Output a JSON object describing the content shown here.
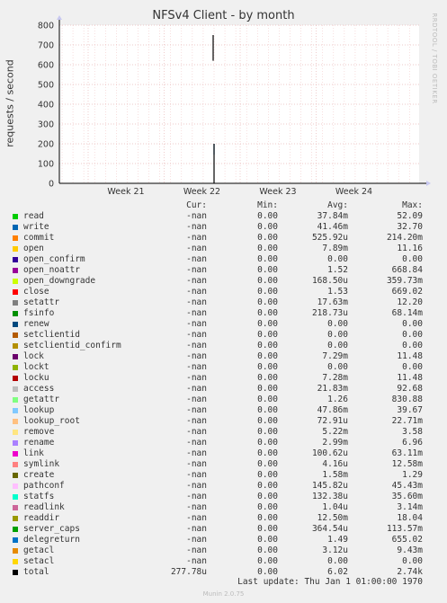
{
  "chart_data": {
    "type": "line",
    "title": "NFSv4 Client - by month",
    "ylabel": "requests / second",
    "ylim": [
      0,
      800
    ],
    "yticks": [
      0,
      100,
      200,
      300,
      400,
      500,
      600,
      700,
      800
    ],
    "xticks": [
      "Week 21",
      "Week 22",
      "Week 23",
      "Week 24"
    ],
    "watermark": "RRDTOOL / TOBI OETIKER",
    "grid": true,
    "spike": {
      "at_week": 22,
      "segments": [
        {
          "series": "total",
          "y0": 620,
          "y1": 750
        },
        {
          "series": "write",
          "y0": 145,
          "y1": 200
        },
        {
          "series": "total",
          "y0": 0,
          "y1": 200
        }
      ]
    },
    "columns": {
      "cur": "Cur:",
      "min": "Min:",
      "avg": "Avg:",
      "max": "Max:"
    },
    "series": [
      {
        "name": "read",
        "color": "#00cc00",
        "cur": "-nan",
        "min": "0.00",
        "avg": "37.84m",
        "max": "52.09"
      },
      {
        "name": "write",
        "color": "#0066b3",
        "cur": "-nan",
        "min": "0.00",
        "avg": "41.46m",
        "max": "32.70"
      },
      {
        "name": "commit",
        "color": "#ff8000",
        "cur": "-nan",
        "min": "0.00",
        "avg": "525.92u",
        "max": "214.20m"
      },
      {
        "name": "open",
        "color": "#ffcc00",
        "cur": "-nan",
        "min": "0.00",
        "avg": "7.89m",
        "max": "11.16"
      },
      {
        "name": "open_confirm",
        "color": "#330099",
        "cur": "-nan",
        "min": "0.00",
        "avg": "0.00",
        "max": "0.00"
      },
      {
        "name": "open_noattr",
        "color": "#990099",
        "cur": "-nan",
        "min": "0.00",
        "avg": "1.52",
        "max": "668.84"
      },
      {
        "name": "open_downgrade",
        "color": "#ccff00",
        "cur": "-nan",
        "min": "0.00",
        "avg": "168.50u",
        "max": "359.73m"
      },
      {
        "name": "close",
        "color": "#ff0000",
        "cur": "-nan",
        "min": "0.00",
        "avg": "1.53",
        "max": "669.02"
      },
      {
        "name": "setattr",
        "color": "#808080",
        "cur": "-nan",
        "min": "0.00",
        "avg": "17.63m",
        "max": "12.20"
      },
      {
        "name": "fsinfo",
        "color": "#008f00",
        "cur": "-nan",
        "min": "0.00",
        "avg": "218.73u",
        "max": "68.14m"
      },
      {
        "name": "renew",
        "color": "#00487d",
        "cur": "-nan",
        "min": "0.00",
        "avg": "0.00",
        "max": "0.00"
      },
      {
        "name": "setclientid",
        "color": "#b35a00",
        "cur": "-nan",
        "min": "0.00",
        "avg": "0.00",
        "max": "0.00"
      },
      {
        "name": "setclientid_confirm",
        "color": "#b38f00",
        "cur": "-nan",
        "min": "0.00",
        "avg": "0.00",
        "max": "0.00"
      },
      {
        "name": "lock",
        "color": "#6b006b",
        "cur": "-nan",
        "min": "0.00",
        "avg": "7.29m",
        "max": "11.48"
      },
      {
        "name": "lockt",
        "color": "#8fb300",
        "cur": "-nan",
        "min": "0.00",
        "avg": "0.00",
        "max": "0.00"
      },
      {
        "name": "locku",
        "color": "#b30000",
        "cur": "-nan",
        "min": "0.00",
        "avg": "7.28m",
        "max": "11.48"
      },
      {
        "name": "access",
        "color": "#bebebe",
        "cur": "-nan",
        "min": "0.00",
        "avg": "21.83m",
        "max": "92.68"
      },
      {
        "name": "getattr",
        "color": "#80ff80",
        "cur": "-nan",
        "min": "0.00",
        "avg": "1.26",
        "max": "830.88"
      },
      {
        "name": "lookup",
        "color": "#80c9ff",
        "cur": "-nan",
        "min": "0.00",
        "avg": "47.86m",
        "max": "39.67"
      },
      {
        "name": "lookup_root",
        "color": "#ffc080",
        "cur": "-nan",
        "min": "0.00",
        "avg": "72.91u",
        "max": "22.71m"
      },
      {
        "name": "remove",
        "color": "#ffe680",
        "cur": "-nan",
        "min": "0.00",
        "avg": "5.22m",
        "max": "3.58"
      },
      {
        "name": "rename",
        "color": "#aa80ff",
        "cur": "-nan",
        "min": "0.00",
        "avg": "2.99m",
        "max": "6.96"
      },
      {
        "name": "link",
        "color": "#ee00cc",
        "cur": "-nan",
        "min": "0.00",
        "avg": "100.62u",
        "max": "63.11m"
      },
      {
        "name": "symlink",
        "color": "#ff8080",
        "cur": "-nan",
        "min": "0.00",
        "avg": "4.16u",
        "max": "12.58m"
      },
      {
        "name": "create",
        "color": "#666600",
        "cur": "-nan",
        "min": "0.00",
        "avg": "1.58m",
        "max": "1.29"
      },
      {
        "name": "pathconf",
        "color": "#ffbfff",
        "cur": "-nan",
        "min": "0.00",
        "avg": "145.82u",
        "max": "45.43m"
      },
      {
        "name": "statfs",
        "color": "#00ffcc",
        "cur": "-nan",
        "min": "0.00",
        "avg": "132.38u",
        "max": "35.60m"
      },
      {
        "name": "readlink",
        "color": "#cc6699",
        "cur": "-nan",
        "min": "0.00",
        "avg": "1.04u",
        "max": "3.14m"
      },
      {
        "name": "readdir",
        "color": "#999900",
        "cur": "-nan",
        "min": "0.00",
        "avg": "12.50m",
        "max": "18.04"
      },
      {
        "name": "server_caps",
        "color": "#00a000",
        "cur": "-nan",
        "min": "0.00",
        "avg": "364.54u",
        "max": "113.57m"
      },
      {
        "name": "delegreturn",
        "color": "#0072c6",
        "cur": "-nan",
        "min": "0.00",
        "avg": "1.49",
        "max": "655.02"
      },
      {
        "name": "getacl",
        "color": "#e68a00",
        "cur": "-nan",
        "min": "0.00",
        "avg": "3.12u",
        "max": "9.43m"
      },
      {
        "name": "setacl",
        "color": "#ffd700",
        "cur": "-nan",
        "min": "0.00",
        "avg": "0.00",
        "max": "0.00"
      },
      {
        "name": "total",
        "color": "#000000",
        "cur": "277.78u",
        "min": "0.00",
        "avg": "6.02",
        "max": "2.74k"
      }
    ]
  },
  "last_update": "Last update: Thu Jan  1 01:00:00 1970",
  "version": "Munin 2.0.75"
}
